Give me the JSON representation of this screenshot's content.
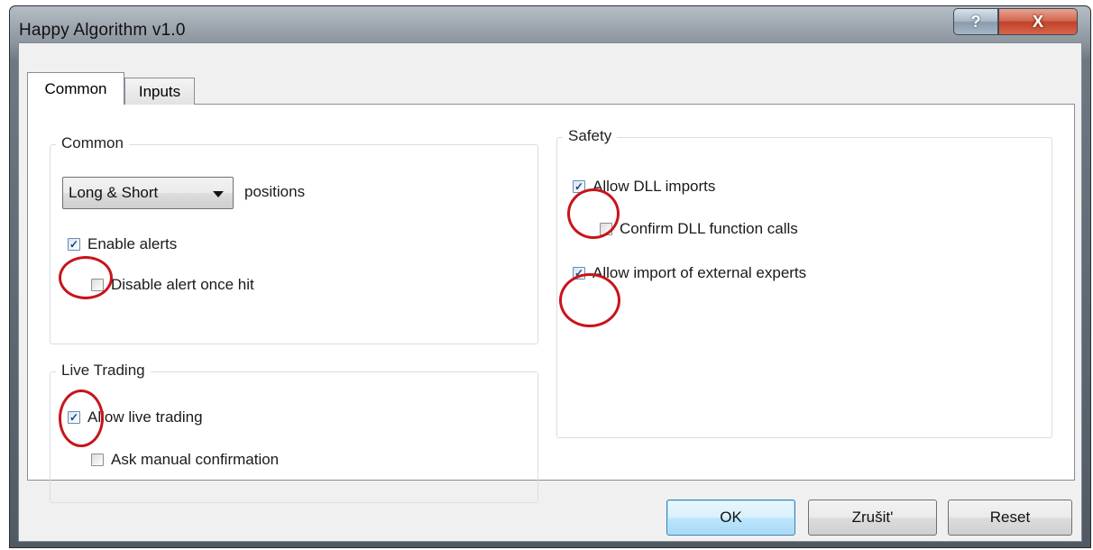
{
  "window": {
    "title": "Happy Algorithm v1.0",
    "help_icon": "?",
    "close_icon": "X"
  },
  "tabs": [
    {
      "label": "Common",
      "active": true
    },
    {
      "label": "Inputs",
      "active": false
    }
  ],
  "common_group": {
    "label": "Common",
    "position_select": {
      "value": "Long & Short"
    },
    "position_suffix": "positions",
    "enable_alerts": {
      "label": "Enable alerts",
      "checked": true
    },
    "disable_alert_once_hit": {
      "label": "Disable alert once hit",
      "checked": false
    }
  },
  "live_trading_group": {
    "label": "Live Trading",
    "allow_live_trading": {
      "label": "Allow live trading",
      "checked": true
    },
    "ask_manual_confirmation": {
      "label": "Ask manual confirmation",
      "checked": false
    }
  },
  "safety_group": {
    "label": "Safety",
    "allow_dll_imports": {
      "label": "Allow DLL imports",
      "checked": true
    },
    "confirm_dll_function_calls": {
      "label": "Confirm DLL function calls",
      "checked": false
    },
    "allow_import_external_experts": {
      "label": "Allow import of external experts",
      "checked": true
    }
  },
  "buttons": {
    "ok": "OK",
    "cancel": "Zrušit'",
    "reset": "Reset"
  },
  "colors": {
    "annotation_circle": "#c8141a",
    "close_button": "#c0432a",
    "default_button_border": "#3c7fb1"
  }
}
